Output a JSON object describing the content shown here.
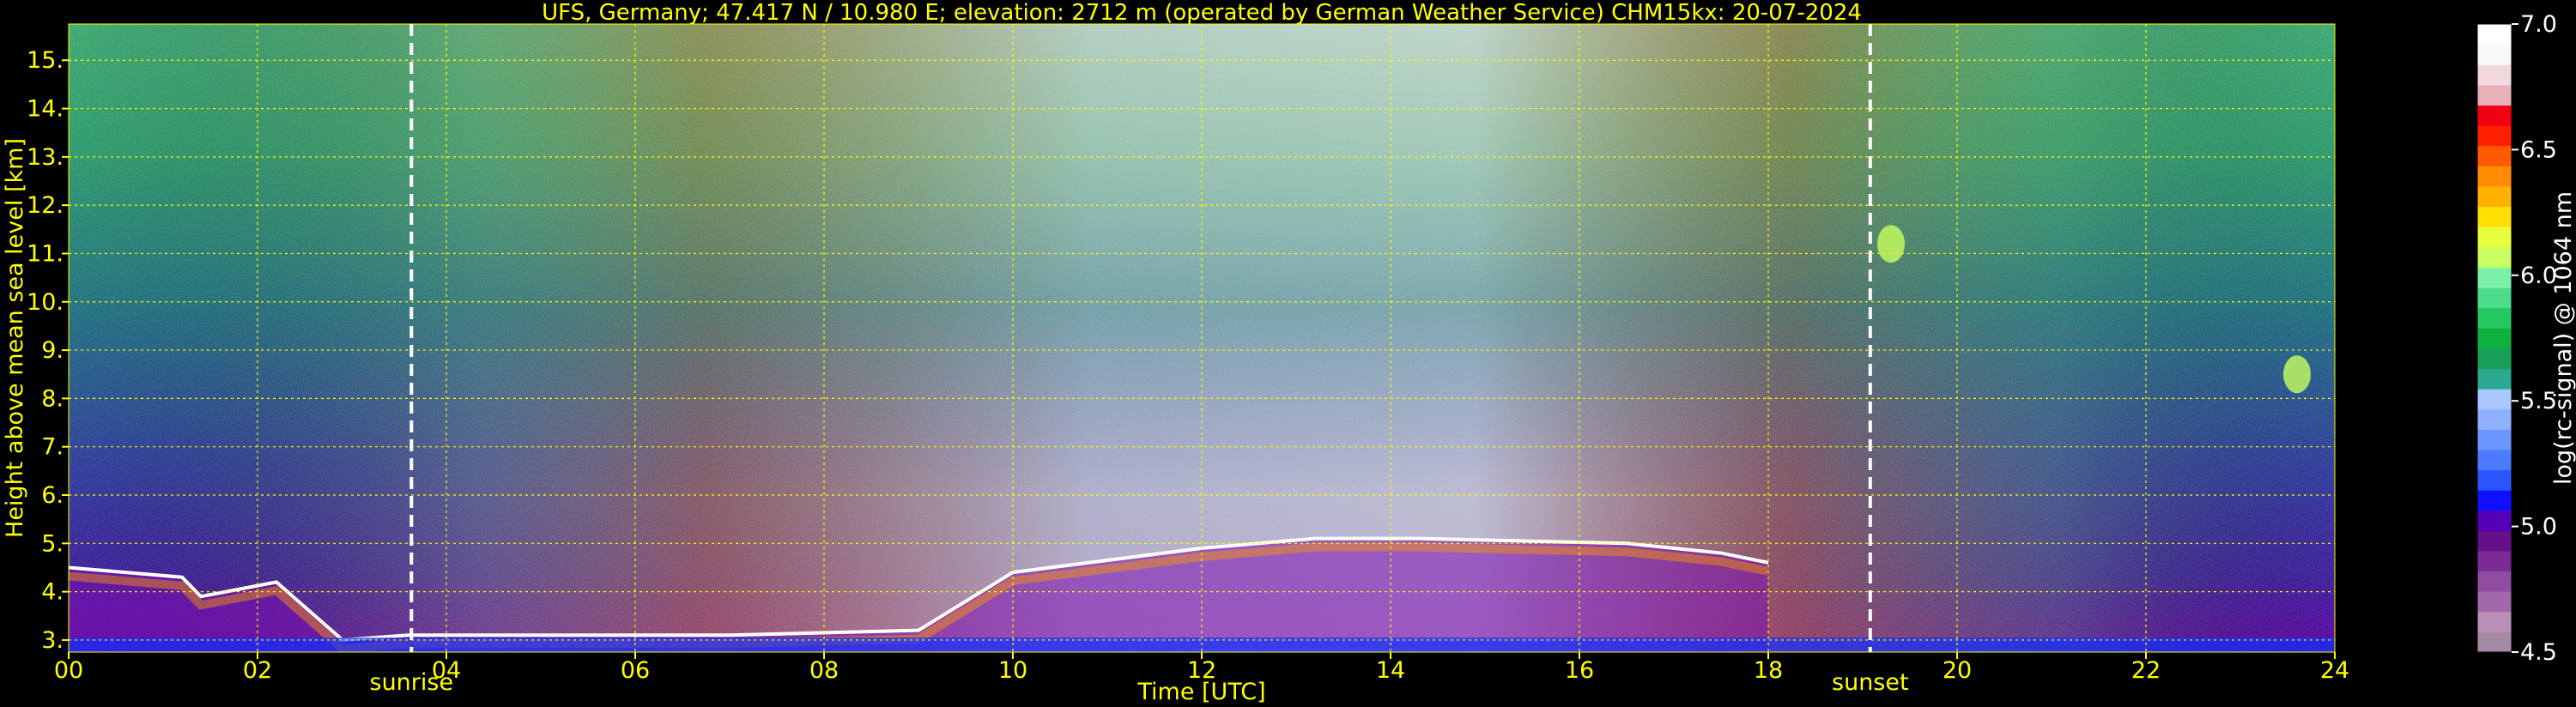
{
  "chart_data": {
    "type": "heatmap",
    "title": "UFS, Germany; 47.417 N / 10.980 E; elevation: 2712 m  (operated by German Weather Service)    CHM15kx: 20-07-2024",
    "xlabel": "Time [UTC]",
    "ylabel": "Height above mean sea level [km]",
    "xlim": [
      0,
      24
    ],
    "ylim": [
      2.75,
      15.75
    ],
    "x_ticks": [
      0,
      2,
      4,
      6,
      8,
      10,
      12,
      14,
      16,
      18,
      20,
      22,
      24
    ],
    "x_tick_labels": [
      "00",
      "02",
      "04",
      "06",
      "08",
      "10",
      "12",
      "14",
      "16",
      "18",
      "20",
      "22",
      "24"
    ],
    "y_ticks": [
      3,
      4,
      5,
      6,
      7,
      8,
      9,
      10,
      11,
      12,
      13,
      14,
      15
    ],
    "y_tick_labels": [
      "3.",
      "4.",
      "5.",
      "6.",
      "7.",
      "8.",
      "9.",
      "10.",
      "11.",
      "12.",
      "13.",
      "14.",
      "15."
    ],
    "grid": true,
    "annotations": [
      {
        "label": "sunrise",
        "x": 3.63
      },
      {
        "label": "sunset",
        "x": 19.08
      }
    ],
    "colorbar": {
      "label": "log(rc-signal) @ 1064 nm",
      "range": [
        4.5,
        7.0
      ],
      "ticks": [
        4.5,
        5.0,
        5.5,
        6.0,
        6.5,
        7.0
      ],
      "tick_labels": [
        "4.5",
        "5.0",
        "5.5",
        "6.0",
        "6.5",
        "7.0"
      ],
      "colors": [
        "#a58aa5",
        "#b890b8",
        "#a06aa8",
        "#8f4ca0",
        "#7c2a95",
        "#650f8a",
        "#5300b8",
        "#1010ff",
        "#2a56ff",
        "#4d7bff",
        "#6d95ff",
        "#8eb0ff",
        "#a8c6ff",
        "#2aa890",
        "#19a058",
        "#10b040",
        "#24c860",
        "#4ddc8c",
        "#7cf0a8",
        "#c8ff60",
        "#e8ff40",
        "#ffe000",
        "#ffb000",
        "#ff8c00",
        "#ff5a00",
        "#ff2000",
        "#f00010",
        "#e8b0b8",
        "#f0d8dc",
        "#f8f8f8",
        "#ffffff"
      ]
    },
    "layers": {
      "boundary_layer_top_km": [
        [
          0.0,
          4.5
        ],
        [
          1.2,
          4.3
        ],
        [
          1.4,
          3.9
        ],
        [
          2.2,
          4.2
        ],
        [
          2.9,
          3.0
        ],
        [
          3.6,
          3.1
        ],
        [
          4.0,
          3.1
        ],
        [
          7.0,
          3.1
        ],
        [
          9.0,
          3.2
        ],
        [
          10.0,
          4.4
        ],
        [
          12.0,
          4.9
        ],
        [
          13.2,
          5.1
        ],
        [
          14.3,
          5.1
        ],
        [
          16.5,
          5.0
        ],
        [
          17.5,
          4.8
        ],
        [
          18.0,
          4.6
        ]
      ],
      "cirrus_patches": [
        {
          "x": 19.3,
          "y": 11.2
        },
        {
          "x": 23.6,
          "y": 8.5
        }
      ]
    }
  }
}
